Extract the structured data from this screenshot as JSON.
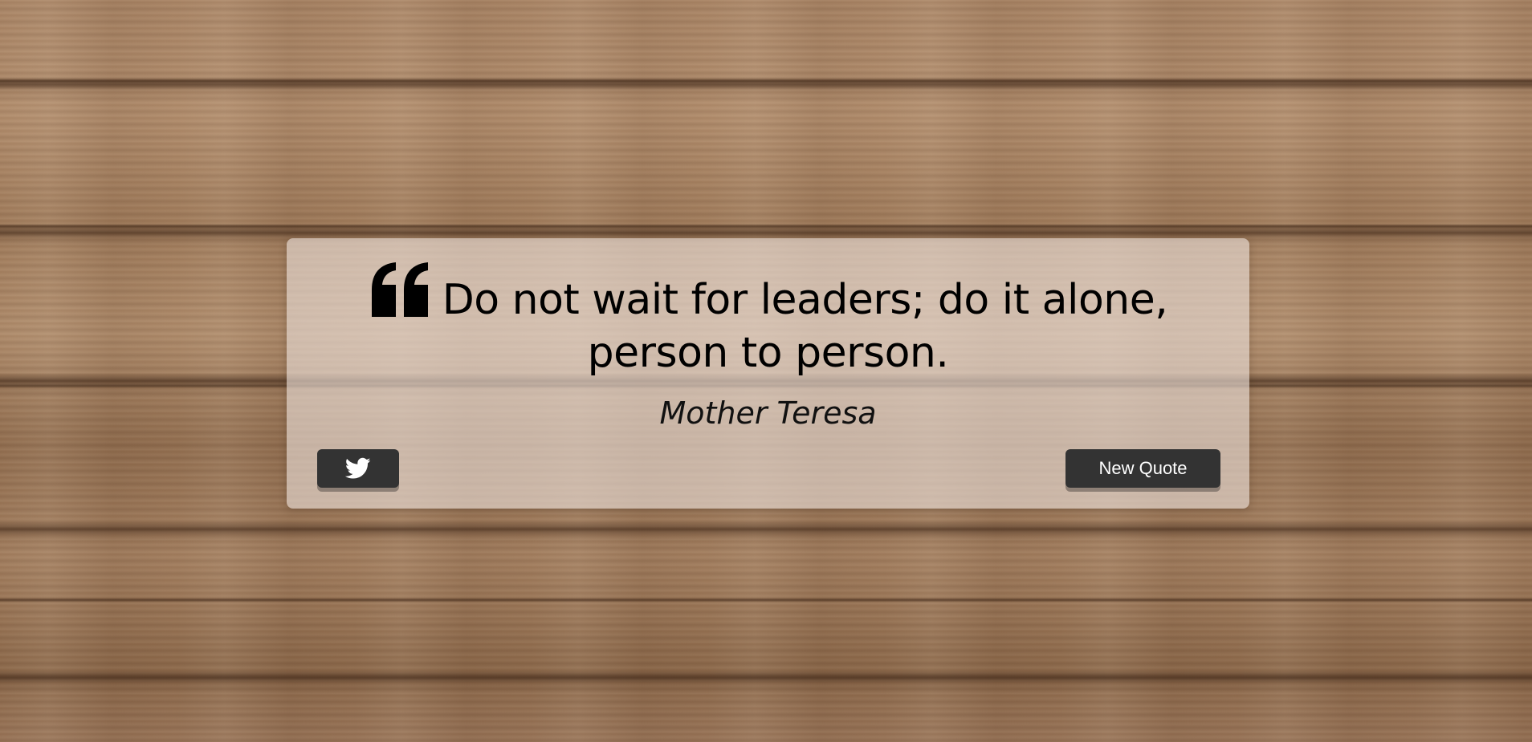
{
  "quote": {
    "text": "Do not wait for leaders; do it alone, person to person.",
    "author": "Mother Teresa"
  },
  "buttons": {
    "tweet_icon": "twitter-icon",
    "new_quote_label": "New Quote"
  },
  "colors": {
    "button_bg": "#333333",
    "button_text": "#ffffff",
    "card_bg": "#ebe1da"
  }
}
